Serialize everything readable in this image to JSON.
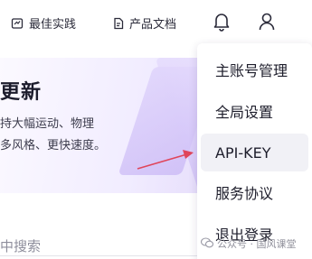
{
  "nav": {
    "best_practice": "最佳实践",
    "product_docs": "产品文档"
  },
  "hero": {
    "title": "更新",
    "line1": "持大幅运动、物理",
    "line2": "多风格、更快速度。"
  },
  "search": {
    "placeholder": "中搜索"
  },
  "menu": {
    "items": [
      "主账号管理",
      "全局设置",
      "API-KEY",
      "服务协议",
      "退出登录"
    ],
    "highlighted": "API-KEY"
  },
  "watermark": {
    "text": "公众号 · 国风课堂"
  },
  "colors": {
    "accent_arrow": "#e0455a",
    "hero_purple": "#e6ddfb"
  }
}
